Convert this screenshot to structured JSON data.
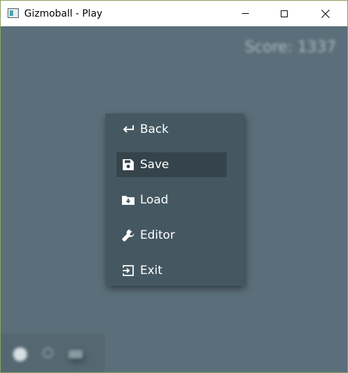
{
  "window": {
    "title": "Gizmoball - Play"
  },
  "game": {
    "score_text": "Score: 1337"
  },
  "menu": {
    "items": [
      {
        "label": "Back",
        "icon": "back-arrow-icon"
      },
      {
        "label": "Save",
        "icon": "floppy-disk-icon",
        "selected": true
      },
      {
        "label": "Load",
        "icon": "folder-download-icon"
      },
      {
        "label": "Editor",
        "icon": "wrench-icon"
      },
      {
        "label": "Exit",
        "icon": "exit-icon"
      }
    ]
  },
  "toolbar": {
    "icons": [
      "play-icon",
      "reload-icon",
      "menu-icon"
    ]
  },
  "colors": {
    "background": "#5b6f7a",
    "menu_bg": "#455862",
    "menu_selected": "#35444b",
    "text": "#ffffff"
  }
}
